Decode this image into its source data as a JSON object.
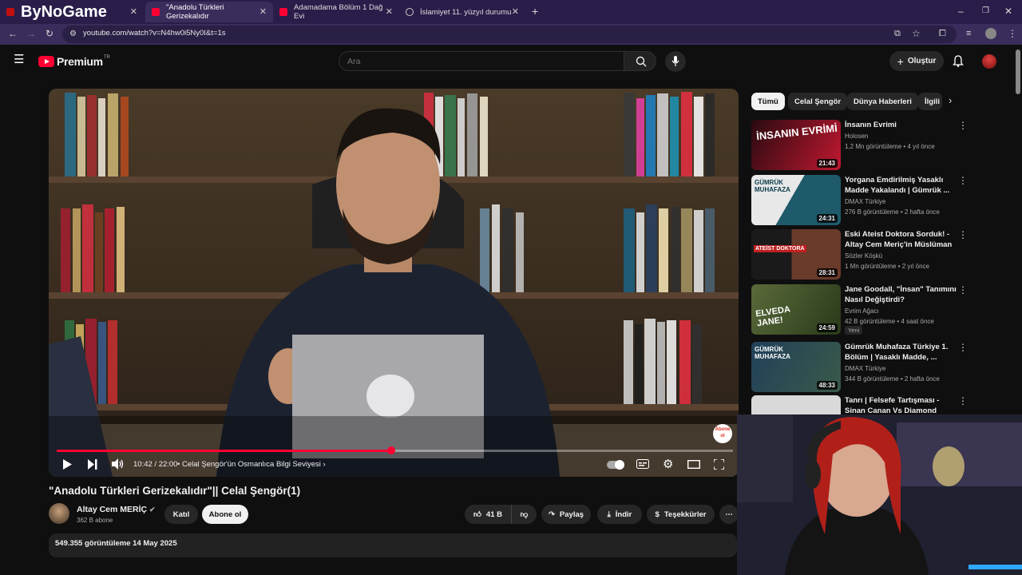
{
  "browser": {
    "tabs": [
      {
        "label": "ByNoGame",
        "active": false
      },
      {
        "label": "\"Anadolu Türkleri Gerizekalıdır",
        "active": true
      },
      {
        "label": "Adamadama Bölüm 1 Dağ Evi",
        "active": false
      },
      {
        "label": "İslamiyet 11. yüzyıl durumu",
        "active": false
      }
    ],
    "url": "youtube.com/watch?v=N4hw0i5Ny0I&t=1s"
  },
  "header": {
    "logo": "Premium",
    "country": "TR",
    "search_placeholder": "Ara",
    "create_label": "Oluştur"
  },
  "player": {
    "progress": 0.495,
    "time": "10:42 / 22:00",
    "chapter": "• Celal Şengör'ün Osmanlıca Bilgi Seviyesi ›",
    "watermark": "Abone ol"
  },
  "video": {
    "title": "\"Anadolu Türkleri Gerizekalıdır\"|| Celal Şengör(1)",
    "channel": "Altay Cem MERİÇ",
    "subscribers": "362 B abone",
    "join_label": "Katıl",
    "subscribe_label": "Abone ol",
    "likes": "41 B",
    "share_label": "Paylaş",
    "download_label": "İndir",
    "thanks_label": "Teşekkürler",
    "views_date": "549.355 görüntüleme  14 May 2025"
  },
  "chips": [
    "Tümü",
    "Celal Şengör",
    "Dünya Haberleri",
    "İlgili"
  ],
  "recommendations": [
    {
      "title": "İnsanın Evrimi",
      "channel": "Holosen",
      "meta": "1,2 Mn görüntüleme • 4 yıl önce",
      "duration": "21:43",
      "thumb_text": "İNSANIN EVRİMİ",
      "color": "#8a1020"
    },
    {
      "title": "Yorgana Emdirilmiş Yasaklı Madde Yakalandı | Gümrük ...",
      "channel": "DMAX Türkiye",
      "meta": "276 B görüntüleme • 2 hafta önce",
      "duration": "24:31",
      "thumb_text": "GÜMRÜK MUHAFAZA",
      "color": "#1e5a6a"
    },
    {
      "title": "Eski Ateist Doktora Sorduk! - Altay Cem Meriç'in Müslüman ...",
      "channel": "Sözler Köşkü",
      "meta": "1 Mn görüntüleme • 2 yıl önce",
      "duration": "28:31",
      "thumb_text": "ATEİST DOKTORA",
      "color": "#4a2020"
    },
    {
      "title": "Jane Goodall, \"İnsan\" Tanımını Nasıl Değiştirdi?",
      "channel": "Evrim Ağacı",
      "meta": "42 B görüntüleme • 4 saat önce",
      "duration": "24:59",
      "thumb_text": "ELVEDA JANE!",
      "color": "#3a4a22",
      "badge": "Yeni"
    },
    {
      "title": "Gümrük Muhafaza Türkiye 1. Bölüm | Yasaklı Madde, ...",
      "channel": "DMAX Türkiye",
      "meta": "344 B görüntüleme • 2 hafta önce",
      "duration": "48:33",
      "thumb_text": "GÜMRÜK MUHAFAZA",
      "color": "#20405a"
    },
    {
      "title": "Tanrı | Felsefe Tartışması - Sinan Canan Vs Diamond Tema",
      "channel": "",
      "meta": "",
      "duration": "",
      "thumb_text": "",
      "color": "#d9d9d9"
    }
  ]
}
